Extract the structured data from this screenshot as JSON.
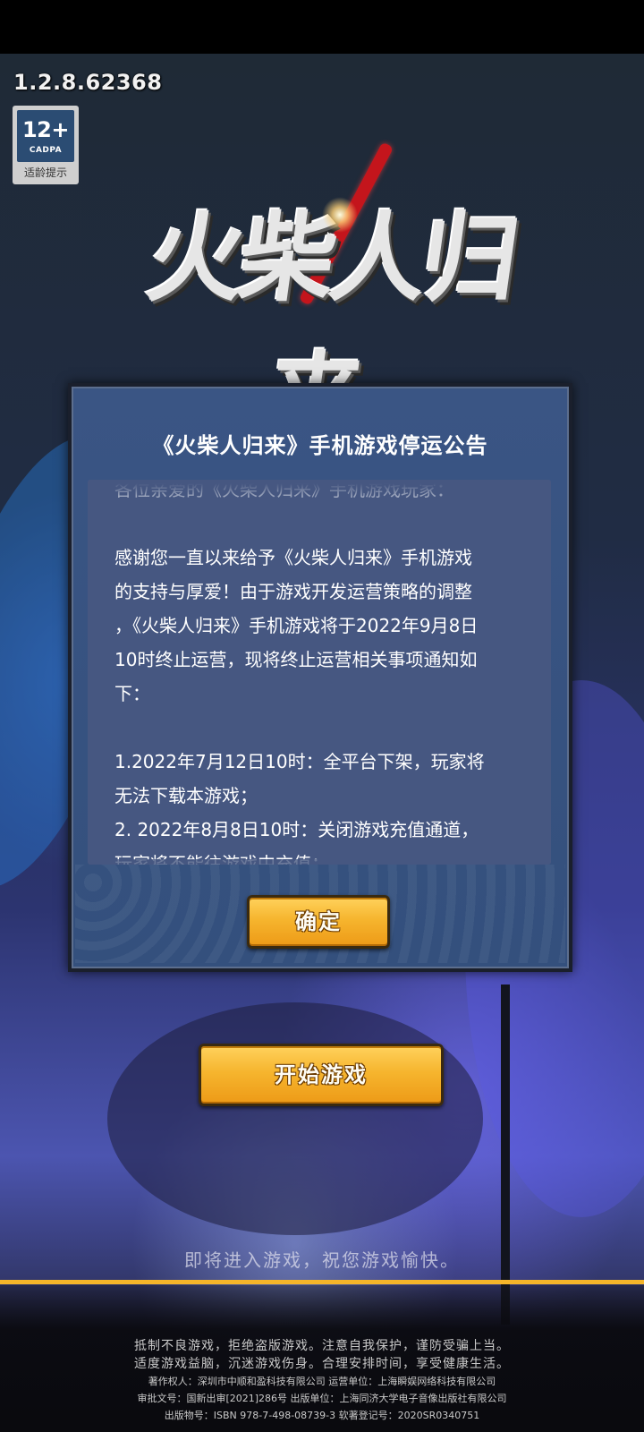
{
  "version": "1.2.8.62368",
  "age_rating": {
    "age": "12+",
    "org": "CADPA",
    "caption": "适龄提示"
  },
  "logo": {
    "text": "火柴人归来"
  },
  "dialog": {
    "title": "《火柴人归来》手机游戏停运公告",
    "lines": [
      "各位亲爱的《火柴人归来》手机游戏玩家：",
      "",
      "感谢您一直以来给予《火柴人归来》手机游戏",
      "的支持与厚爱！由于游戏开发运营策略的调整",
      "，《火柴人归来》手机游戏将于2022年9月8日",
      "10时终止运营，现将终止运营相关事项通知如",
      "下：",
      "",
      "1.2022年7月12日10时：全平台下架，玩家将",
      "无法下载本游戏；",
      "2. 2022年8月8日10时：关闭游戏充值通道，",
      "玩家将不能往游戏中充值；"
    ],
    "confirm_label": "确定"
  },
  "start_button_label": "开始游戏",
  "loading_tip": "即将进入游戏，祝您游戏愉快。",
  "progress": 1.0,
  "footer": {
    "health_notice_1": "抵制不良游戏，拒绝盗版游戏。注意自我保护，谨防受骗上当。",
    "health_notice_2": "适度游戏益脑，沉迷游戏伤身。合理安排时间，享受健康生活。",
    "copyright": "著作权人：深圳市中顺和盈科技有限公司  运营单位：上海瞬娱网络科技有限公司",
    "approval": "审批文号：国新出审[2021]286号  出版单位：上海同济大学电子音像出版社有限公司",
    "isbn": "出版物号：ISBN 978-7-498-08739-3  软著登记号：2020SR0340751"
  },
  "colors": {
    "accent": "#f5b52a",
    "dialog_bg": "#3a5584",
    "text_panel": "#465781",
    "logo_red": "#c4151c"
  }
}
